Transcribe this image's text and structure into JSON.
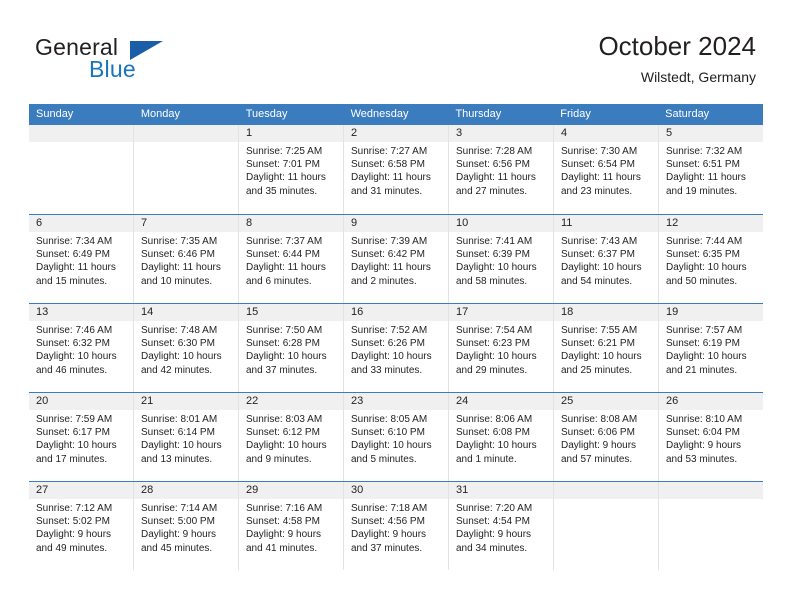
{
  "brand": {
    "name_part1": "General",
    "name_part2": "Blue",
    "accent_color": "#1b75bb",
    "triangle_color": "#1b5ea8"
  },
  "header": {
    "month_title": "October 2024",
    "location": "Wilstedt, Germany"
  },
  "calendar": {
    "header_color": "#3a7cbe",
    "daynum_band_color": "#f0f0f0",
    "weekday_headers": [
      "Sunday",
      "Monday",
      "Tuesday",
      "Wednesday",
      "Thursday",
      "Friday",
      "Saturday"
    ],
    "weeks": [
      [
        {
          "day": "",
          "sunrise": "",
          "sunset": "",
          "daylight_line1": "",
          "daylight_line2": "",
          "empty": true
        },
        {
          "day": "",
          "sunrise": "",
          "sunset": "",
          "daylight_line1": "",
          "daylight_line2": "",
          "empty": true
        },
        {
          "day": "1",
          "sunrise": "Sunrise: 7:25 AM",
          "sunset": "Sunset: 7:01 PM",
          "daylight_line1": "Daylight: 11 hours",
          "daylight_line2": "and 35 minutes."
        },
        {
          "day": "2",
          "sunrise": "Sunrise: 7:27 AM",
          "sunset": "Sunset: 6:58 PM",
          "daylight_line1": "Daylight: 11 hours",
          "daylight_line2": "and 31 minutes."
        },
        {
          "day": "3",
          "sunrise": "Sunrise: 7:28 AM",
          "sunset": "Sunset: 6:56 PM",
          "daylight_line1": "Daylight: 11 hours",
          "daylight_line2": "and 27 minutes."
        },
        {
          "day": "4",
          "sunrise": "Sunrise: 7:30 AM",
          "sunset": "Sunset: 6:54 PM",
          "daylight_line1": "Daylight: 11 hours",
          "daylight_line2": "and 23 minutes."
        },
        {
          "day": "5",
          "sunrise": "Sunrise: 7:32 AM",
          "sunset": "Sunset: 6:51 PM",
          "daylight_line1": "Daylight: 11 hours",
          "daylight_line2": "and 19 minutes."
        }
      ],
      [
        {
          "day": "6",
          "sunrise": "Sunrise: 7:34 AM",
          "sunset": "Sunset: 6:49 PM",
          "daylight_line1": "Daylight: 11 hours",
          "daylight_line2": "and 15 minutes."
        },
        {
          "day": "7",
          "sunrise": "Sunrise: 7:35 AM",
          "sunset": "Sunset: 6:46 PM",
          "daylight_line1": "Daylight: 11 hours",
          "daylight_line2": "and 10 minutes."
        },
        {
          "day": "8",
          "sunrise": "Sunrise: 7:37 AM",
          "sunset": "Sunset: 6:44 PM",
          "daylight_line1": "Daylight: 11 hours",
          "daylight_line2": "and 6 minutes."
        },
        {
          "day": "9",
          "sunrise": "Sunrise: 7:39 AM",
          "sunset": "Sunset: 6:42 PM",
          "daylight_line1": "Daylight: 11 hours",
          "daylight_line2": "and 2 minutes."
        },
        {
          "day": "10",
          "sunrise": "Sunrise: 7:41 AM",
          "sunset": "Sunset: 6:39 PM",
          "daylight_line1": "Daylight: 10 hours",
          "daylight_line2": "and 58 minutes."
        },
        {
          "day": "11",
          "sunrise": "Sunrise: 7:43 AM",
          "sunset": "Sunset: 6:37 PM",
          "daylight_line1": "Daylight: 10 hours",
          "daylight_line2": "and 54 minutes."
        },
        {
          "day": "12",
          "sunrise": "Sunrise: 7:44 AM",
          "sunset": "Sunset: 6:35 PM",
          "daylight_line1": "Daylight: 10 hours",
          "daylight_line2": "and 50 minutes."
        }
      ],
      [
        {
          "day": "13",
          "sunrise": "Sunrise: 7:46 AM",
          "sunset": "Sunset: 6:32 PM",
          "daylight_line1": "Daylight: 10 hours",
          "daylight_line2": "and 46 minutes."
        },
        {
          "day": "14",
          "sunrise": "Sunrise: 7:48 AM",
          "sunset": "Sunset: 6:30 PM",
          "daylight_line1": "Daylight: 10 hours",
          "daylight_line2": "and 42 minutes."
        },
        {
          "day": "15",
          "sunrise": "Sunrise: 7:50 AM",
          "sunset": "Sunset: 6:28 PM",
          "daylight_line1": "Daylight: 10 hours",
          "daylight_line2": "and 37 minutes."
        },
        {
          "day": "16",
          "sunrise": "Sunrise: 7:52 AM",
          "sunset": "Sunset: 6:26 PM",
          "daylight_line1": "Daylight: 10 hours",
          "daylight_line2": "and 33 minutes."
        },
        {
          "day": "17",
          "sunrise": "Sunrise: 7:54 AM",
          "sunset": "Sunset: 6:23 PM",
          "daylight_line1": "Daylight: 10 hours",
          "daylight_line2": "and 29 minutes."
        },
        {
          "day": "18",
          "sunrise": "Sunrise: 7:55 AM",
          "sunset": "Sunset: 6:21 PM",
          "daylight_line1": "Daylight: 10 hours",
          "daylight_line2": "and 25 minutes."
        },
        {
          "day": "19",
          "sunrise": "Sunrise: 7:57 AM",
          "sunset": "Sunset: 6:19 PM",
          "daylight_line1": "Daylight: 10 hours",
          "daylight_line2": "and 21 minutes."
        }
      ],
      [
        {
          "day": "20",
          "sunrise": "Sunrise: 7:59 AM",
          "sunset": "Sunset: 6:17 PM",
          "daylight_line1": "Daylight: 10 hours",
          "daylight_line2": "and 17 minutes."
        },
        {
          "day": "21",
          "sunrise": "Sunrise: 8:01 AM",
          "sunset": "Sunset: 6:14 PM",
          "daylight_line1": "Daylight: 10 hours",
          "daylight_line2": "and 13 minutes."
        },
        {
          "day": "22",
          "sunrise": "Sunrise: 8:03 AM",
          "sunset": "Sunset: 6:12 PM",
          "daylight_line1": "Daylight: 10 hours",
          "daylight_line2": "and 9 minutes."
        },
        {
          "day": "23",
          "sunrise": "Sunrise: 8:05 AM",
          "sunset": "Sunset: 6:10 PM",
          "daylight_line1": "Daylight: 10 hours",
          "daylight_line2": "and 5 minutes."
        },
        {
          "day": "24",
          "sunrise": "Sunrise: 8:06 AM",
          "sunset": "Sunset: 6:08 PM",
          "daylight_line1": "Daylight: 10 hours",
          "daylight_line2": "and 1 minute."
        },
        {
          "day": "25",
          "sunrise": "Sunrise: 8:08 AM",
          "sunset": "Sunset: 6:06 PM",
          "daylight_line1": "Daylight: 9 hours",
          "daylight_line2": "and 57 minutes."
        },
        {
          "day": "26",
          "sunrise": "Sunrise: 8:10 AM",
          "sunset": "Sunset: 6:04 PM",
          "daylight_line1": "Daylight: 9 hours",
          "daylight_line2": "and 53 minutes."
        }
      ],
      [
        {
          "day": "27",
          "sunrise": "Sunrise: 7:12 AM",
          "sunset": "Sunset: 5:02 PM",
          "daylight_line1": "Daylight: 9 hours",
          "daylight_line2": "and 49 minutes."
        },
        {
          "day": "28",
          "sunrise": "Sunrise: 7:14 AM",
          "sunset": "Sunset: 5:00 PM",
          "daylight_line1": "Daylight: 9 hours",
          "daylight_line2": "and 45 minutes."
        },
        {
          "day": "29",
          "sunrise": "Sunrise: 7:16 AM",
          "sunset": "Sunset: 4:58 PM",
          "daylight_line1": "Daylight: 9 hours",
          "daylight_line2": "and 41 minutes."
        },
        {
          "day": "30",
          "sunrise": "Sunrise: 7:18 AM",
          "sunset": "Sunset: 4:56 PM",
          "daylight_line1": "Daylight: 9 hours",
          "daylight_line2": "and 37 minutes."
        },
        {
          "day": "31",
          "sunrise": "Sunrise: 7:20 AM",
          "sunset": "Sunset: 4:54 PM",
          "daylight_line1": "Daylight: 9 hours",
          "daylight_line2": "and 34 minutes."
        },
        {
          "day": "",
          "sunrise": "",
          "sunset": "",
          "daylight_line1": "",
          "daylight_line2": "",
          "empty": true
        },
        {
          "day": "",
          "sunrise": "",
          "sunset": "",
          "daylight_line1": "",
          "daylight_line2": "",
          "empty": true
        }
      ]
    ]
  }
}
